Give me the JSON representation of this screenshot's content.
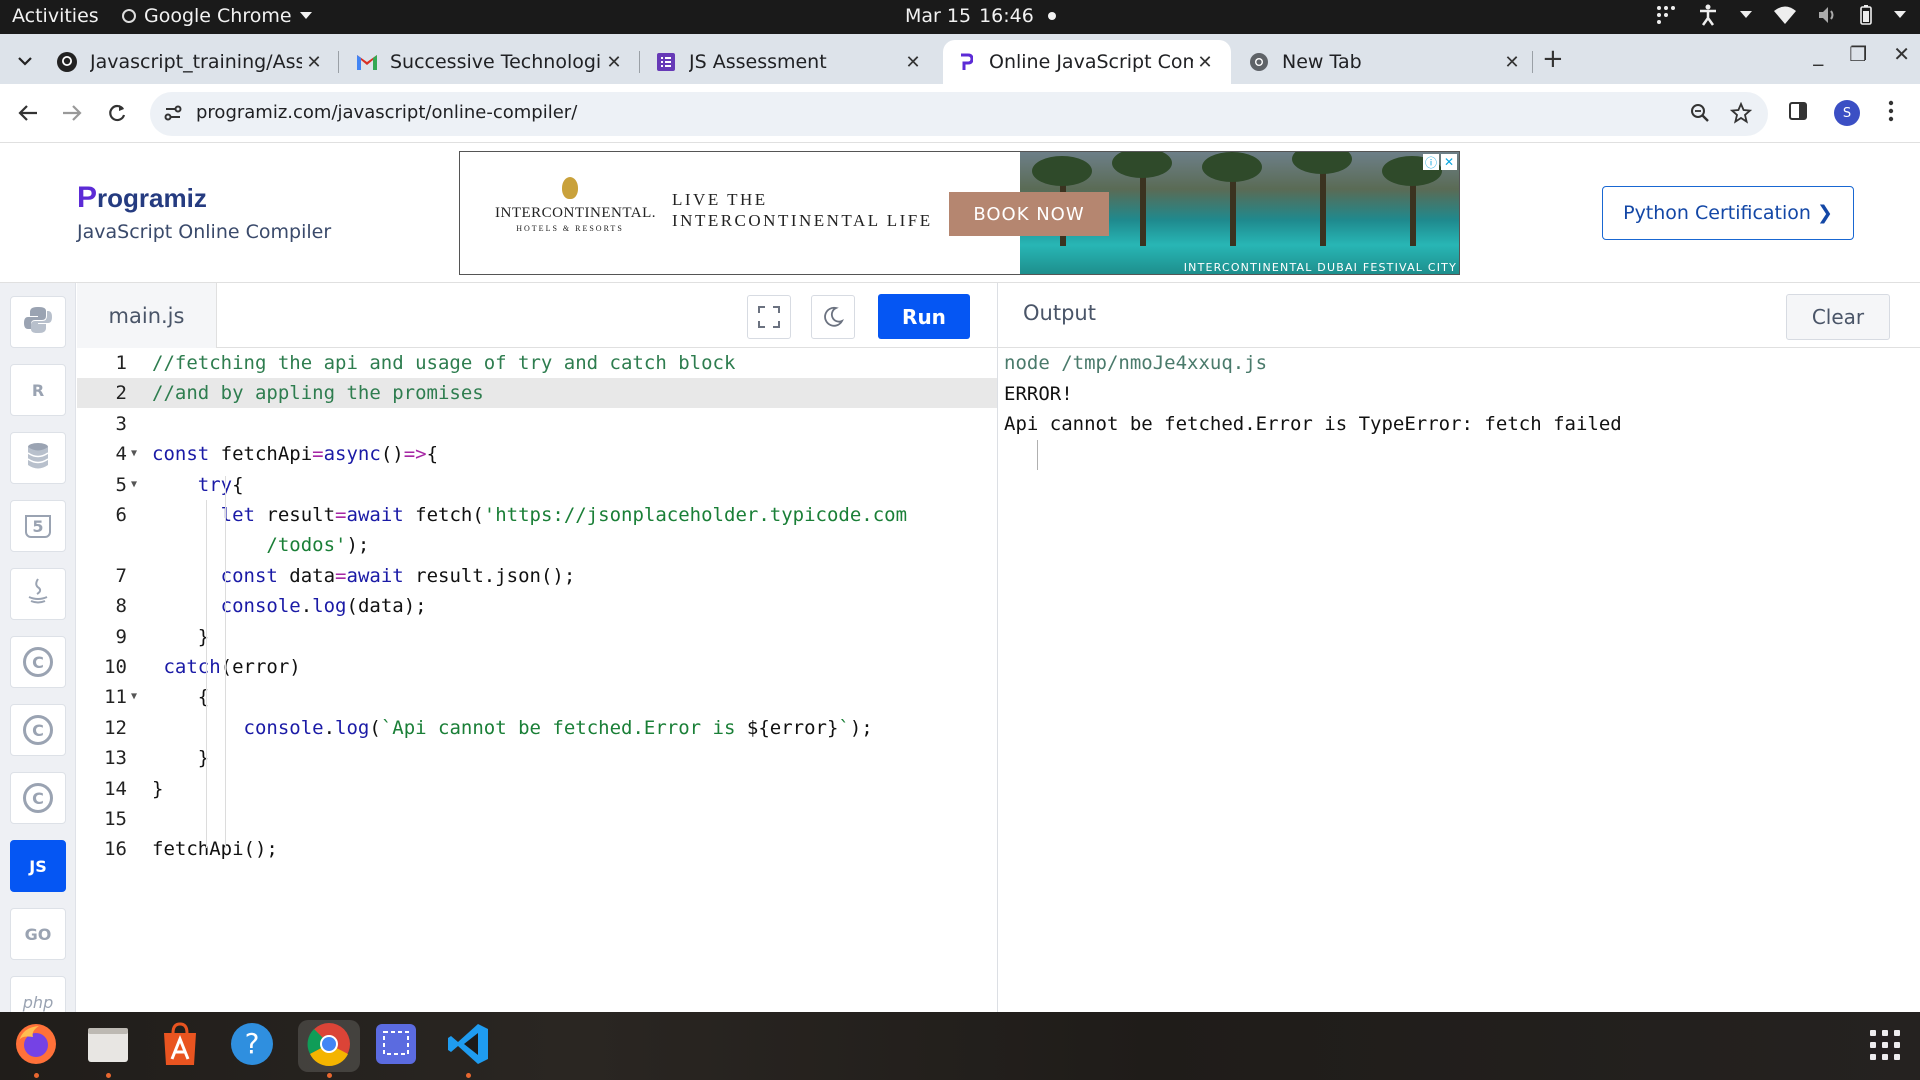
{
  "system": {
    "activities": "Activities",
    "app_name": "Google Chrome",
    "date": "Mar 15",
    "time": "16:46"
  },
  "tabs": [
    {
      "title": "Javascript_training/Assig",
      "icon": "github-icon"
    },
    {
      "title": "Successive Technologies",
      "icon": "gmail-icon"
    },
    {
      "title": "JS Assessment",
      "icon": "forms-icon"
    },
    {
      "title": "Online JavaScript Compi",
      "icon": "programiz-icon",
      "active": true
    },
    {
      "title": "New Tab",
      "icon": "chrome-icon"
    }
  ],
  "address_bar": {
    "url": "programiz.com/javascript/online-compiler/"
  },
  "profile_initial": "S",
  "site": {
    "logo": "rogramiz",
    "logo_p": "P",
    "subtitle": "JavaScript Online Compiler",
    "certification_button": "Python Certification",
    "certification_chevron": "❯"
  },
  "ad": {
    "brand": "INTERCONTINENTAL.",
    "brand_sub": "HOTELS & RESORTS",
    "tagline_1": "LIVE THE",
    "tagline_2": "INTERCONTINENTAL LIFE",
    "cta": "BOOK NOW",
    "caption": "INTERCONTINENTAL DUBAI FESTIVAL CITY"
  },
  "languages": [
    {
      "name": "python",
      "label": "",
      "active": false
    },
    {
      "name": "r",
      "label": "R",
      "active": false
    },
    {
      "name": "sql",
      "label": "",
      "active": false
    },
    {
      "name": "html",
      "label": "5",
      "active": false
    },
    {
      "name": "java",
      "label": "",
      "active": false
    },
    {
      "name": "c",
      "label": "C",
      "active": false
    },
    {
      "name": "cpp",
      "label": "C",
      "active": false
    },
    {
      "name": "csharp",
      "label": "C",
      "active": false
    },
    {
      "name": "javascript",
      "label": "JS",
      "active": true
    },
    {
      "name": "go",
      "label": "GO",
      "active": false
    },
    {
      "name": "php",
      "label": "php",
      "active": false
    }
  ],
  "editor": {
    "file_name": "main.js",
    "run_label": "Run",
    "lines": [
      {
        "n": "1",
        "chunks": [
          {
            "c": "cmt",
            "t": "//fetching the api and usage of try and catch block"
          }
        ]
      },
      {
        "n": "2",
        "hl": true,
        "chunks": [
          {
            "c": "cmt",
            "t": "//and by appling the promises"
          }
        ]
      },
      {
        "n": "3",
        "chunks": []
      },
      {
        "n": "4",
        "fold": true,
        "chunks": [
          {
            "c": "kw",
            "t": "const"
          },
          {
            "c": "def",
            "t": " fetchApi"
          },
          {
            "c": "op",
            "t": "="
          },
          {
            "c": "kw",
            "t": "async"
          },
          {
            "c": "def",
            "t": "()"
          },
          {
            "c": "op",
            "t": "=>"
          },
          {
            "c": "def",
            "t": "{"
          }
        ]
      },
      {
        "n": "5",
        "fold": true,
        "chunks": [
          {
            "c": "def",
            "t": "    "
          },
          {
            "c": "kw",
            "t": "try"
          },
          {
            "c": "def",
            "t": "{"
          }
        ]
      },
      {
        "n": "6",
        "chunks": [
          {
            "c": "def",
            "t": "      "
          },
          {
            "c": "kw",
            "t": "let"
          },
          {
            "c": "def",
            "t": " result"
          },
          {
            "c": "op",
            "t": "="
          },
          {
            "c": "kw",
            "t": "await"
          },
          {
            "c": "def",
            "t": " fetch("
          },
          {
            "c": "str",
            "t": "'https://jsonplaceholder.typicode.com"
          }
        ]
      },
      {
        "n": "",
        "chunks": [
          {
            "c": "str",
            "t": "          /todos'"
          },
          {
            "c": "def",
            "t": ");"
          }
        ]
      },
      {
        "n": "7",
        "chunks": [
          {
            "c": "def",
            "t": "      "
          },
          {
            "c": "kw",
            "t": "const"
          },
          {
            "c": "def",
            "t": " data"
          },
          {
            "c": "op",
            "t": "="
          },
          {
            "c": "kw",
            "t": "await"
          },
          {
            "c": "def",
            "t": " result.json();"
          }
        ]
      },
      {
        "n": "8",
        "chunks": [
          {
            "c": "def",
            "t": "      "
          },
          {
            "c": "fn",
            "t": "console"
          },
          {
            "c": "def",
            "t": "."
          },
          {
            "c": "fn",
            "t": "log"
          },
          {
            "c": "def",
            "t": "(data);"
          }
        ]
      },
      {
        "n": "9",
        "chunks": [
          {
            "c": "def",
            "t": "    }"
          }
        ]
      },
      {
        "n": "10",
        "chunks": [
          {
            "c": "def",
            "t": " "
          },
          {
            "c": "kw",
            "t": "catch"
          },
          {
            "c": "def",
            "t": "(error)"
          }
        ]
      },
      {
        "n": "11",
        "fold": true,
        "chunks": [
          {
            "c": "def",
            "t": "    {"
          }
        ]
      },
      {
        "n": "12",
        "chunks": [
          {
            "c": "def",
            "t": "        "
          },
          {
            "c": "fn",
            "t": "console"
          },
          {
            "c": "def",
            "t": "."
          },
          {
            "c": "fn",
            "t": "log"
          },
          {
            "c": "def",
            "t": "("
          },
          {
            "c": "str",
            "t": "`Api cannot be fetched.Error is "
          },
          {
            "c": "def",
            "t": "${error}"
          },
          {
            "c": "str",
            "t": "`"
          },
          {
            "c": "def",
            "t": ");"
          }
        ]
      },
      {
        "n": "13",
        "chunks": [
          {
            "c": "def",
            "t": "    }"
          }
        ]
      },
      {
        "n": "14",
        "chunks": [
          {
            "c": "def",
            "t": "}"
          }
        ]
      },
      {
        "n": "15",
        "chunks": []
      },
      {
        "n": "16",
        "chunks": [
          {
            "c": "def",
            "t": "fetchApi();"
          }
        ]
      }
    ]
  },
  "output": {
    "title": "Output",
    "clear_label": "Clear",
    "lines": [
      {
        "kind": "cmd",
        "text": "node /tmp/nmoJe4xxuq.js"
      },
      {
        "kind": "out",
        "text": "ERROR!"
      },
      {
        "kind": "out",
        "text": "Api cannot be fetched.Error is TypeError: fetch failed"
      }
    ]
  },
  "dock": [
    {
      "name": "firefox",
      "running": true
    },
    {
      "name": "files",
      "running": true
    },
    {
      "name": "software",
      "running": false
    },
    {
      "name": "help",
      "running": false
    },
    {
      "name": "chrome",
      "running": true
    },
    {
      "name": "screenshot",
      "running": false
    },
    {
      "name": "vscode",
      "running": true
    }
  ]
}
